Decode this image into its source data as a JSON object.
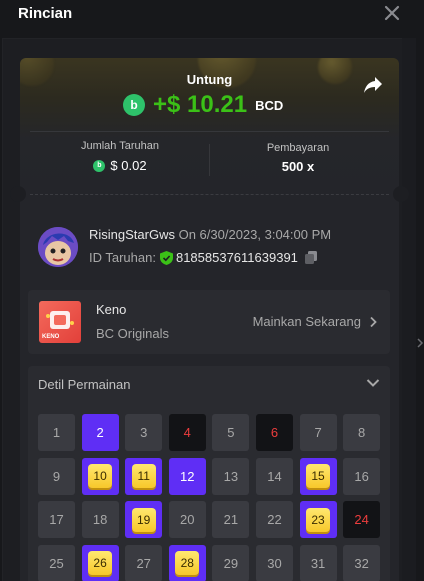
{
  "header": {
    "title": "Rincian"
  },
  "hero": {
    "profit_label": "Untung",
    "profit_value": "+$ 10.21",
    "currency": "BCD",
    "bet_label": "Jumlah Taruhan",
    "bet_value": "$ 0.02",
    "payout_label": "Pembayaran",
    "payout_value": "500 x"
  },
  "user": {
    "name": "RisingStarGws",
    "on_text": "On 6/30/2023, 3:04:00 PM",
    "bet_id_label": "ID Taruhan:",
    "bet_id": "81858537611639391"
  },
  "game": {
    "name": "Keno",
    "provider": "BC Originals",
    "play_label": "Mainkan Sekarang",
    "thumb_text": "KENO"
  },
  "details": {
    "title": "Detil Permainan",
    "cells": [
      {
        "n": "1",
        "state": "normal"
      },
      {
        "n": "2",
        "state": "hit"
      },
      {
        "n": "3",
        "state": "normal"
      },
      {
        "n": "4",
        "state": "miss"
      },
      {
        "n": "5",
        "state": "normal"
      },
      {
        "n": "6",
        "state": "miss"
      },
      {
        "n": "7",
        "state": "normal"
      },
      {
        "n": "8",
        "state": "normal"
      },
      {
        "n": "9",
        "state": "normal"
      },
      {
        "n": "10",
        "state": "win"
      },
      {
        "n": "11",
        "state": "win"
      },
      {
        "n": "12",
        "state": "hit"
      },
      {
        "n": "13",
        "state": "normal"
      },
      {
        "n": "14",
        "state": "normal"
      },
      {
        "n": "15",
        "state": "win"
      },
      {
        "n": "16",
        "state": "normal"
      },
      {
        "n": "17",
        "state": "normal"
      },
      {
        "n": "18",
        "state": "normal"
      },
      {
        "n": "19",
        "state": "win"
      },
      {
        "n": "20",
        "state": "normal"
      },
      {
        "n": "21",
        "state": "normal"
      },
      {
        "n": "22",
        "state": "normal"
      },
      {
        "n": "23",
        "state": "win"
      },
      {
        "n": "24",
        "state": "miss"
      },
      {
        "n": "25",
        "state": "normal"
      },
      {
        "n": "26",
        "state": "win"
      },
      {
        "n": "27",
        "state": "normal"
      },
      {
        "n": "28",
        "state": "win"
      },
      {
        "n": "29",
        "state": "normal"
      },
      {
        "n": "30",
        "state": "normal"
      },
      {
        "n": "31",
        "state": "normal"
      },
      {
        "n": "32",
        "state": "normal"
      }
    ]
  },
  "icons": {
    "close": "close-icon",
    "share": "share-icon",
    "currency": "bcd-coin-icon",
    "verified": "shield-check-icon",
    "copy": "copy-icon",
    "chevron": "chevron-right-icon",
    "collapse": "chevron-down-icon"
  },
  "colors": {
    "profit": "#3bc117",
    "accent": "#5f2ef5",
    "miss": "#ec3d3d",
    "gem": "#f7c82a"
  }
}
